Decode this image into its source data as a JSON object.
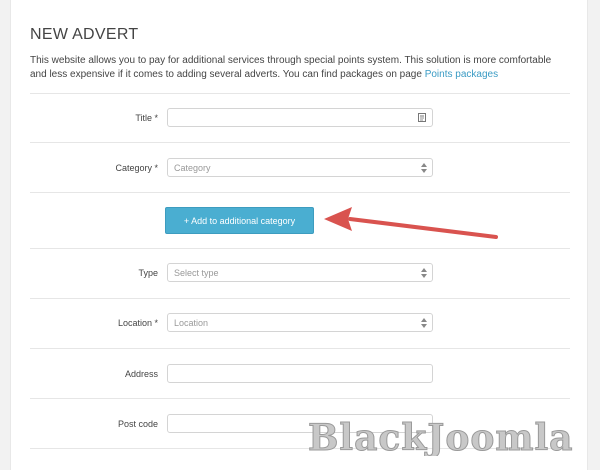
{
  "page": {
    "title": "NEW ADVERT",
    "intro": "This website allows you to pay for additional services through special points system. This solution is more comfortable and less expensive if it comes to adding several adverts. You can find packages on page ",
    "intro_link": "Points packages"
  },
  "form": {
    "title_label": "Title *",
    "category_label": "Category *",
    "category_placeholder": "Category",
    "add_category_button": "+ Add to additional category",
    "type_label": "Type",
    "type_placeholder": "Select type",
    "location_label": "Location *",
    "location_placeholder": "Location",
    "address_label": "Address",
    "postcode_label": "Post code"
  },
  "watermark": "BlackJoomla",
  "colors": {
    "accent": "#4aaed1",
    "link": "#3a9bc4",
    "arrow": "#d9534f"
  },
  "icons": {
    "title_field_icon": "calendar-icon",
    "select_icon": "chevron-updown-icon"
  }
}
